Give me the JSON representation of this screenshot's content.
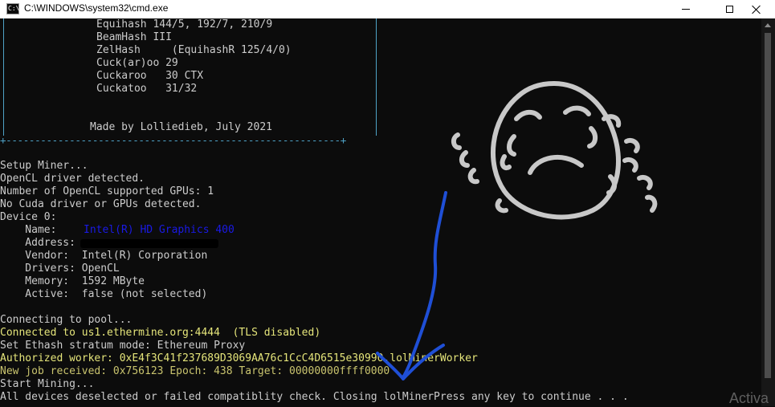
{
  "window": {
    "title": "C:\\WINDOWS\\system32\\cmd.exe",
    "icon": "cmd-icon",
    "icon_text": "C:\\",
    "controls": [
      "minimize-icon",
      "maximize-icon",
      "close-icon"
    ]
  },
  "banner": {
    "algorithms": [
      "Equihash 144/5, 192/7, 210/9",
      "BeamHash III",
      "ZelHash     (EquihashR 125/4/0)",
      "Cuck(ar)oo 29",
      "Cuckaroo   30 CTX",
      "Cuckatoo   31/32"
    ],
    "credit": "Made by Lolliedieb, July 2021",
    "border_line": "+----------------------------------------------------------+"
  },
  "setup": {
    "lines": [
      "Setup Miner...",
      "OpenCL driver detected.",
      "Number of OpenCL supported GPUs: 1",
      "No Cuda driver or GPUs detected.",
      "Device 0:"
    ],
    "device": {
      "name_label": "    Name:    ",
      "name_value": "Intel(R) HD Graphics 400",
      "address_label": "    Address: ",
      "vendor": "    Vendor:  Intel(R) Corporation",
      "drivers": "    Drivers: OpenCL",
      "memory": "    Memory:  1592 MByte",
      "active": "    Active:  false (not selected)"
    }
  },
  "log": {
    "connecting": "Connecting to pool...",
    "connected": "Connected to us1.ethermine.org:4444  (TLS disabled)",
    "stratum": "Set Ethash stratum mode: Ethereum Proxy",
    "authorized": "Authorized worker: 0xE4f3C41f237689D3069AA76c1CcC4D6515e30990.lolMinerWorker",
    "new_job": "New job received: 0x756123 Epoch: 438 Target: 00000000ffff0000",
    "start": "Start Mining...",
    "error": "All devices deselected or failed compatiblity check. Closing lolMinerPress any key to continue . . ."
  },
  "watermark": "Activa",
  "colors": {
    "background": "#0c0c0c",
    "text": "#cccccc",
    "highlight_yellow": "#e5e57a",
    "device_name_blue": "#1a1ae6",
    "annotation_blue": "#1f4fd6",
    "doodle_gray": "#c8c8c8"
  }
}
